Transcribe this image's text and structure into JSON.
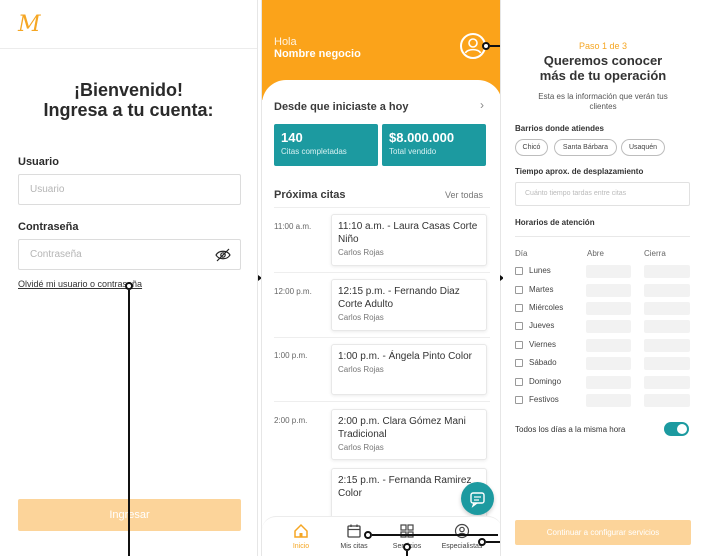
{
  "login": {
    "logo": "M",
    "welcome_line1": "¡Bienvenido!",
    "welcome_line2": "Ingresa a tu cuenta:",
    "usuario_label": "Usuario",
    "usuario_placeholder": "Usuario",
    "password_label": "Contraseña",
    "password_placeholder": "Contraseña",
    "forgot_link": "Olvidé mi usuario o contraseña",
    "login_button": "Ingresar"
  },
  "dashboard": {
    "greeting": "Hola",
    "business_name": "Nombre negocio",
    "since_title": "Desde que iniciaste a hoy",
    "stats": [
      {
        "value": "140",
        "label": "Citas completadas"
      },
      {
        "value": "$8.000.000",
        "label": "Total vendido"
      }
    ],
    "upcoming_title": "Próxima citas",
    "see_all": "Ver todas",
    "appointments": [
      {
        "time": "11:00 a.m.",
        "title": "11:10 a.m. - Laura Casas Corte Niño",
        "person": "Carlos Rojas"
      },
      {
        "time": "12:00 p.m.",
        "title": "12:15 p.m. - Fernando Diaz Corte Adulto",
        "person": "Carlos Rojas"
      },
      {
        "time": "1:00 p.m.",
        "title": "1:00 p.m. - Ángela Pinto Color",
        "person": "Carlos Rojas"
      },
      {
        "time": "2:00 p.m.",
        "title": "2:00 p.m. Clara Gómez Mani Tradicional",
        "person": "Carlos Rojas"
      },
      {
        "time": "",
        "title": "2:15 p.m. - Fernanda Ramirez Color",
        "person": ""
      }
    ],
    "nav": [
      {
        "label": "Inicio",
        "icon": "home-icon"
      },
      {
        "label": "Mis citas",
        "icon": "calendar-icon"
      },
      {
        "label": "Servicios",
        "icon": "grid-icon"
      },
      {
        "label": "Especialistas",
        "icon": "user-icon"
      }
    ]
  },
  "onboarding": {
    "step": "Paso 1 de 3",
    "title_line1": "Queremos conocer",
    "title_line2": "más de tu operación",
    "subtitle": "Esta es la información que verán tus clientes",
    "barrios_label": "Barrios donde atiendes",
    "barrios": [
      "Chicó",
      "Santa Bárbara",
      "Usaquén"
    ],
    "travel_label": "Tiempo aprox. de desplazamiento",
    "travel_placeholder": "Cuánto tiempo tardas entre citas",
    "hours_label": "Horarios de atención",
    "col_day": "Día",
    "col_open": "Abre",
    "col_close": "Cierra",
    "days": [
      "Lunes",
      "Martes",
      "Miércoles",
      "Jueves",
      "Viernes",
      "Sábado",
      "Domingo",
      "Festivos"
    ],
    "same_all_label": "Todos los días a la misma hora",
    "same_all_enabled": true,
    "continue_button": "Continuar a configurar servicios"
  },
  "colors": {
    "brand_orange": "#fba31a",
    "light_orange": "#fcd49a",
    "teal": "#1c9aa0"
  }
}
